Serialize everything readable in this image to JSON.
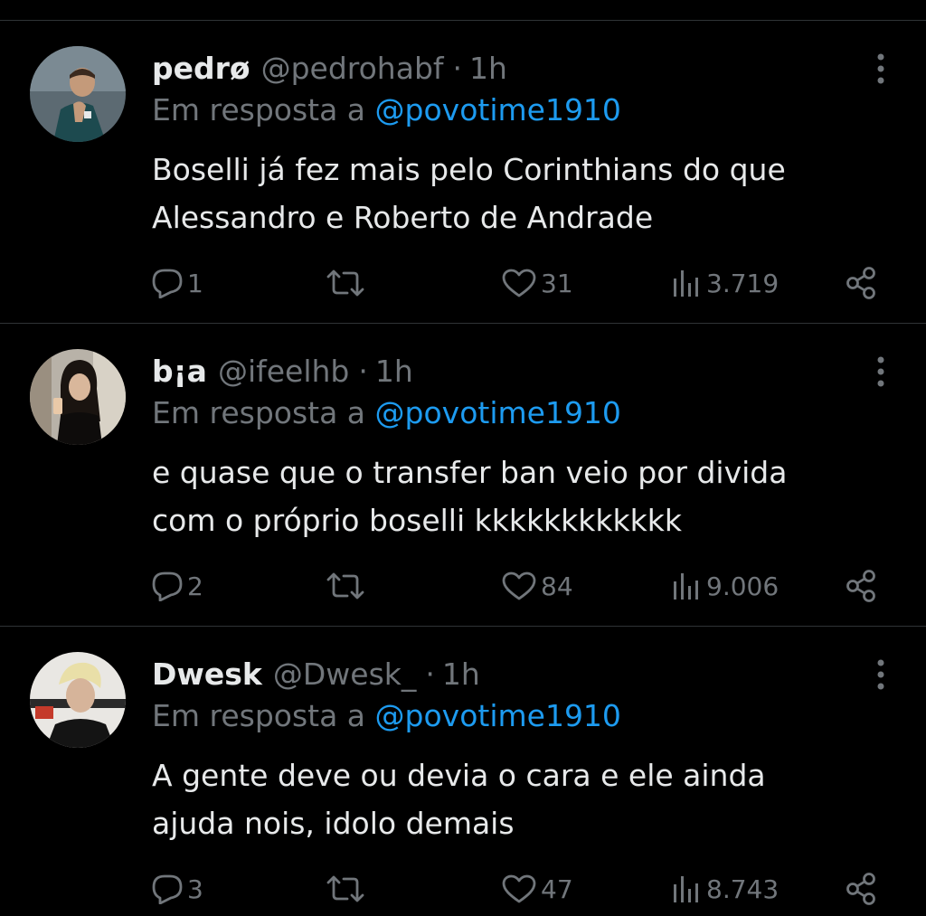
{
  "tweets": [
    {
      "name": "pedrø",
      "handle": "@pedrohabf",
      "dot": "·",
      "time": "1h",
      "reply_prefix": "Em resposta a ",
      "reply_mention": "@povotime1910",
      "lines": [
        "Boselli já fez mais pelo Corinthians do que",
        "Alessandro e Roberto de Andrade"
      ],
      "replies": "1",
      "likes": "31",
      "views": "3.719"
    },
    {
      "name": "b¡a",
      "handle": "@ifeelhb",
      "dot": "·",
      "time": "1h",
      "reply_prefix": "Em resposta a ",
      "reply_mention": "@povotime1910",
      "lines": [
        "e quase que o transfer ban veio por divida",
        "com o próprio boselli kkkkkkkkkkkk"
      ],
      "replies": "2",
      "likes": "84",
      "views": "9.006"
    },
    {
      "name": "Dwesk",
      "handle": "@Dwesk_",
      "dot": "·",
      "time": "1h",
      "reply_prefix": "Em resposta a ",
      "reply_mention": "@povotime1910",
      "lines": [
        "A gente deve ou devia o cara e ele ainda",
        "ajuda nois, idolo demais"
      ],
      "replies": "3",
      "likes": "47",
      "views": "8.743"
    }
  ],
  "icons": {
    "reply": "reply-icon",
    "retweet": "retweet-icon",
    "like": "heart-icon",
    "views": "views-icon",
    "share": "share-icon",
    "more": "more-vertical-icon"
  },
  "colors": {
    "background": "#000000",
    "text": "#e7e9ea",
    "muted": "#71767b",
    "link": "#1d9bf0",
    "divider": "#2f3336"
  }
}
